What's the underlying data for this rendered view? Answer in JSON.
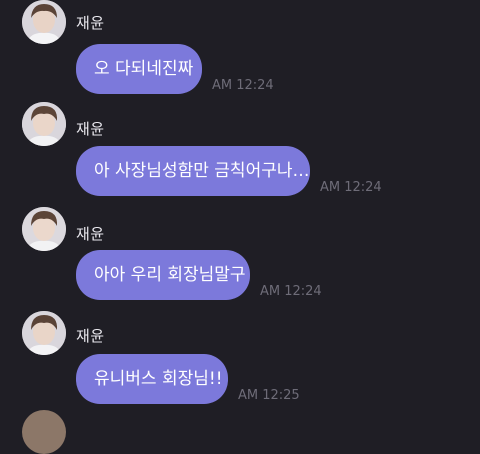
{
  "messages": [
    {
      "sender": "재윤",
      "text": "오 다되네진짜",
      "time": "AM 12:24"
    },
    {
      "sender": "재윤",
      "text": "아 사장님성함만 금칙어구나…",
      "time": "AM 12:24"
    },
    {
      "sender": "재윤",
      "text": "아아 우리 회장님말구",
      "time": "AM 12:24"
    },
    {
      "sender": "재윤",
      "text": "유니버스 회장님!!",
      "time": "AM 12:25"
    }
  ],
  "colors": {
    "background": "#1f1e25",
    "bubble": "#7c79db",
    "bubble_text": "#ffffff",
    "name_text": "#e9e8ee",
    "time_text": "#6e6c78"
  },
  "icons": {
    "avatar": "profile-photo-avatar"
  }
}
